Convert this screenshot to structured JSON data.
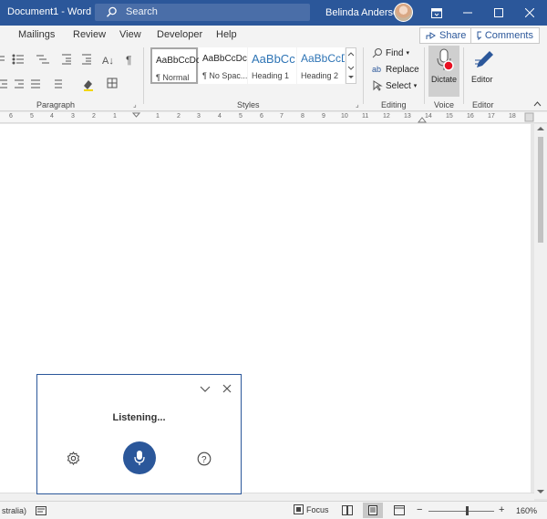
{
  "titlebar": {
    "doc_title": "Document1 - Word",
    "search_placeholder": "Search",
    "user_name": "Belinda Anderson"
  },
  "ribbon": {
    "tabs": [
      "Mailings",
      "Review",
      "View",
      "Developer",
      "Help"
    ],
    "share_label": "Share",
    "comments_label": "Comments",
    "styles": [
      {
        "sample": "AaBbCcDc",
        "name": "¶ Normal"
      },
      {
        "sample": "AaBbCcDc",
        "name": "¶ No Spac..."
      },
      {
        "sample": "AaBbCc",
        "name": "Heading 1"
      },
      {
        "sample": "AaBbCcD",
        "name": "Heading 2"
      }
    ],
    "editing": {
      "find": "Find",
      "replace": "Replace",
      "select": "Select"
    },
    "dictate_label": "Dictate",
    "editor_label": "Editor",
    "groups": {
      "paragraph": "Paragraph",
      "styles": "Styles",
      "editing": "Editing",
      "voice": "Voice",
      "editor": "Editor"
    }
  },
  "ruler": {
    "ticks": [
      "6",
      "5",
      "4",
      "3",
      "2",
      "1",
      "1",
      "2",
      "3",
      "4",
      "5",
      "6",
      "7",
      "8",
      "9",
      "10",
      "11",
      "12",
      "13",
      "14",
      "15",
      "16",
      "17",
      "18"
    ]
  },
  "dictation": {
    "status": "Listening..."
  },
  "statusbar": {
    "language": "stralia)",
    "focus_label": "Focus",
    "zoom_minus": "−",
    "zoom_plus": "+",
    "zoom_level": "160%"
  },
  "colors": {
    "brand_blue": "#2b579a",
    "record_red": "#e81123"
  }
}
